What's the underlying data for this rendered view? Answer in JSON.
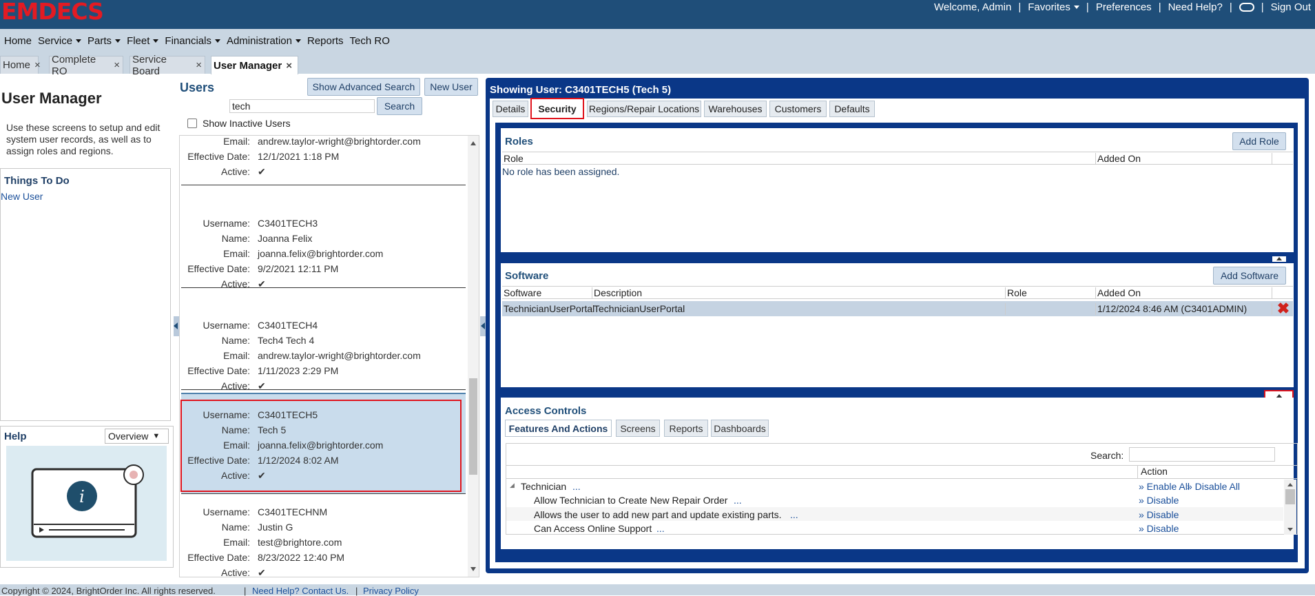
{
  "app": {
    "logo": "EMDECS"
  },
  "topbar": {
    "welcome": "Welcome, Admin",
    "favorites": "Favorites",
    "preferences": "Preferences",
    "need_help": "Need Help?",
    "sign_out": "Sign Out"
  },
  "menu": {
    "home": "Home",
    "service": "Service",
    "parts": "Parts",
    "fleet": "Fleet",
    "financials": "Financials",
    "administration": "Administration",
    "reports": "Reports",
    "tech_ro": "Tech RO"
  },
  "pagetabs": [
    {
      "label": "Home"
    },
    {
      "label": "Complete RO"
    },
    {
      "label": "Service Board"
    },
    {
      "label": "User Manager"
    }
  ],
  "left": {
    "title": "User Manager",
    "description": "Use these screens to setup and edit system user records, as well as to assign roles and regions.",
    "todo_title": "Things To Do",
    "todo_link": "New User",
    "help_title": "Help",
    "help_select": "Overview"
  },
  "users": {
    "heading": "Users",
    "advanced_search": "Show Advanced Search",
    "new_user": "New User",
    "search_value": "tech",
    "search_button": "Search",
    "inactive_label": "Show Inactive Users",
    "labels": {
      "username": "Username:",
      "name": "Name:",
      "email": "Email:",
      "effective": "Effective Date:",
      "active": "Active:"
    },
    "check": "✔",
    "cards": [
      {
        "username": "",
        "name": "",
        "email": "andrew.taylor-wright@brightorder.com",
        "effective": "12/1/2021 1:18 PM"
      },
      {
        "username": "C3401TECH3",
        "name": "Joanna Felix",
        "email": "joanna.felix@brightorder.com",
        "effective": "9/2/2021 12:11 PM"
      },
      {
        "username": "C3401TECH4",
        "name": "Tech4 Tech 4",
        "email": "andrew.taylor-wright@brightorder.com",
        "effective": "1/11/2023 2:29 PM"
      },
      {
        "username": "C3401TECH5",
        "name": "Tech 5",
        "email": "joanna.felix@brightorder.com",
        "effective": "1/12/2024 8:02 AM"
      },
      {
        "username": "C3401TECHNM",
        "name": "Justin G",
        "email": "test@brightore.com",
        "effective": "8/23/2022 12:40 PM"
      }
    ]
  },
  "detail": {
    "showing": "Showing User: C3401TECH5 (Tech 5)",
    "tabs": [
      "Details",
      "Security",
      "Regions/Repair Locations",
      "Warehouses",
      "Customers",
      "Defaults"
    ],
    "roles": {
      "title": "Roles",
      "add": "Add Role",
      "col_role": "Role",
      "col_added": "Added On",
      "empty": "No role has been assigned."
    },
    "software": {
      "title": "Software",
      "add": "Add Software",
      "cols": [
        "Software",
        "Description",
        "Role",
        "Added On"
      ],
      "row": {
        "software": "TechnicianUserPortal",
        "description": "TechnicianUserPortal",
        "role": "",
        "added": "1/12/2024 8:46 AM (C3401ADMIN)"
      }
    },
    "access": {
      "title": "Access Controls",
      "subtabs": [
        "Features And Actions",
        "Screens",
        "Reports",
        "Dashboards"
      ],
      "search_label": "Search:",
      "action_header": "Action",
      "group": "Technician",
      "enable_all": "» Enable All",
      "disable_all": "» Disable All",
      "ellipsis": "...",
      "disable": "» Disable",
      "items": [
        "Allow Technician to Create New Repair Order",
        "Allows the user to add new part and update existing parts.",
        "Can Access Online Support"
      ]
    }
  },
  "footer": {
    "copyright": "Copyright © 2024, BrightOrder Inc. All rights reserved.",
    "contact": "Need Help? Contact Us.",
    "privacy": "Privacy Policy"
  },
  "colors": {
    "header": "#1f4e79",
    "accent_red": "#e21b23",
    "panel_blue": "#0a3787",
    "menubar": "#c9d6e2"
  }
}
